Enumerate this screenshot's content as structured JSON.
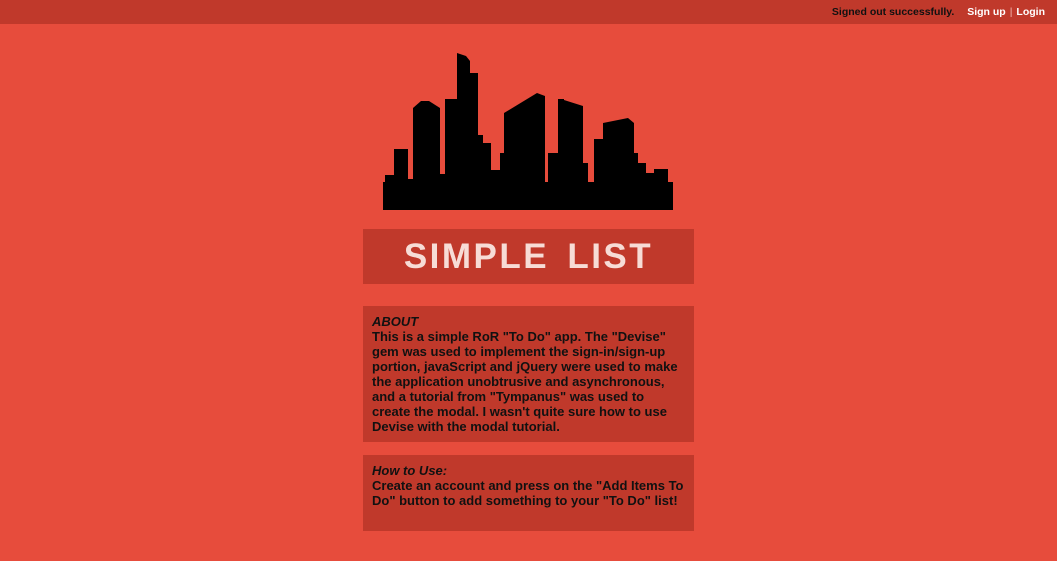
{
  "topbar": {
    "flash_message": "Signed out successfully.",
    "signup_label": "Sign up",
    "separator": "|",
    "login_label": "Login"
  },
  "header": {
    "logo_icon": "city-skyline-icon",
    "title": "SIMPLE LIST"
  },
  "about": {
    "heading": "ABOUT",
    "body": "This is a simple RoR \"To Do\" app. The \"Devise\" gem was used to implement the sign-in/sign-up portion, javaScript and jQuery were used to make the application unobtrusive and asynchronous, and a tutorial from \"Tympanus\" was used to create the modal. I wasn't quite sure how to use Devise with the modal tutorial."
  },
  "how_to_use": {
    "heading": "How to Use:",
    "body": "Create an account and press on the \"Add Items To Do\" button to add something to your \"To Do\" list!"
  },
  "colors": {
    "background": "#e74c3c",
    "panel": "#c0392b",
    "title_text": "#f7dcd6"
  }
}
